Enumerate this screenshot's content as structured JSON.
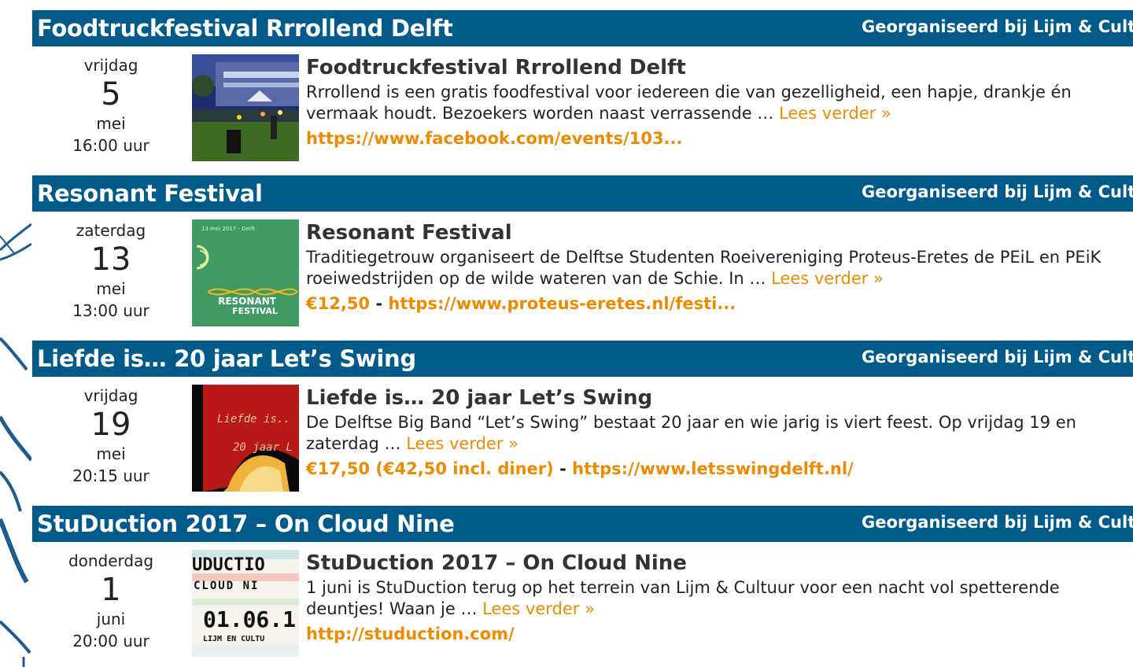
{
  "events": [
    {
      "header_title": "Foodtruckfestival Rrrollend Delft",
      "organizer": "Georganiseerd bij Lijm & Cultuur",
      "weekday": "vrijdag",
      "day": "5",
      "month": "mei",
      "time": "16:00 uur",
      "title": "Foodtruckfestival Rrrollend Delft",
      "description": "Rrrollend is een gratis foodfestival voor iedereen die van gezelligheid, een hapje, drankje én vermaak houdt. Bezoekers worden naast verrassende … ",
      "more": "Lees verder »",
      "price": "",
      "link": "https://www.facebook.com/events/103..."
    },
    {
      "header_title": "Resonant Festival",
      "organizer": "Georganiseerd bij Lijm & Cultuur",
      "weekday": "zaterdag",
      "day": "13",
      "month": "mei",
      "time": "13:00 uur",
      "title": "Resonant Festival",
      "description": "Traditiegetrouw organiseert de Delftse Studenten Roeivereniging Proteus-Eretes de PEiL en PEiK roeiwedstrijden op de wilde wateren van de Schie. In … ",
      "more": "Lees verder »",
      "price": "€12,50",
      "link": "https://www.proteus-eretes.nl/festi...",
      "thumb_text": {
        "top": "13 mei 2017 - Delft",
        "line1": "RESONANT",
        "line2": "FESTIVAL"
      }
    },
    {
      "header_title": "Liefde is… 20 jaar Let’s Swing",
      "organizer": "Georganiseerd bij Lijm & Cultuur",
      "weekday": "vrijdag",
      "day": "19",
      "month": "mei",
      "time": "20:15 uur",
      "title": "Liefde is… 20 jaar Let’s Swing",
      "description": "De Delftse Big Band “Let’s Swing” bestaat 20 jaar en wie jarig is viert feest. Op vrijdag 19 en zaterdag … ",
      "more": "Lees verder »",
      "price": "€17,50 (€42,50 incl. diner)",
      "link": "https://www.letsswingdelft.nl/",
      "thumb_text": {
        "line1": "Liefde is..",
        "line2": "20 jaar L"
      }
    },
    {
      "header_title": "StuDuction 2017 – On Cloud Nine",
      "organizer": "Georganiseerd bij Lijm & Cultuur",
      "weekday": "donderdag",
      "day": "1",
      "month": "juni",
      "time": "20:00 uur",
      "title": "StuDuction 2017 – On Cloud Nine",
      "description": "1 juni is StuDuction terug op het terrein van Lijm & Cultuur voor een nacht vol spetterende deuntjes! Waan je … ",
      "more": "Lees verder »",
      "price": "",
      "link": "http://studuction.com/",
      "thumb_text": {
        "line1": "UDUCTIO",
        "line2": "CLOUD NI",
        "line3": "01.06.1",
        "line4": "LIJM EN CULTU"
      }
    }
  ],
  "colors": {
    "header_bg": "#005a8a",
    "accent": "#ef8a00"
  }
}
